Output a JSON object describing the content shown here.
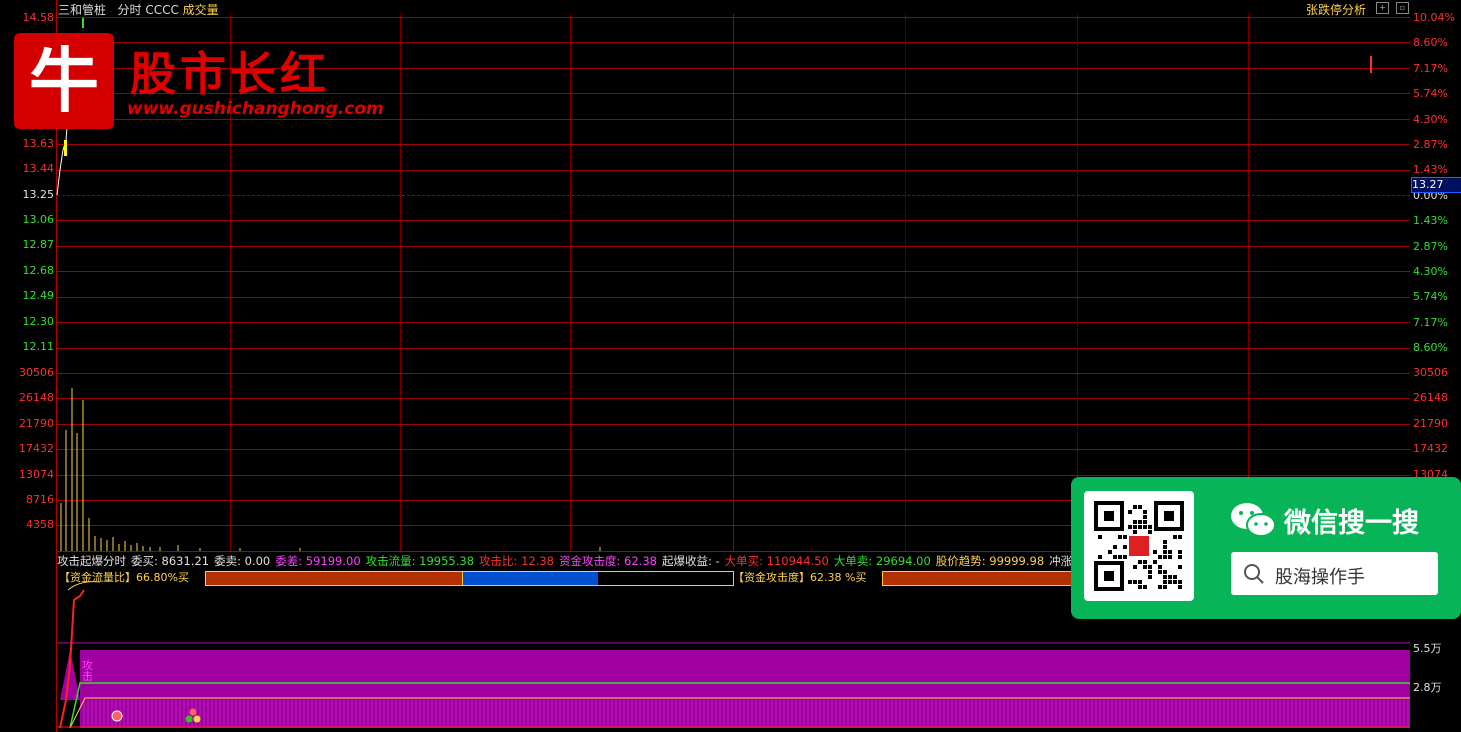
{
  "header": {
    "stock_name": "三和管桩",
    "mode": "分时",
    "code": "CCCC",
    "indicator": "成交量",
    "analysis_link": "张跌停分析"
  },
  "price_axis": {
    "left_labels": [
      {
        "text": "14.58",
        "color": "red"
      },
      {
        "text": "13.63",
        "color": "red"
      },
      {
        "text": "13.44",
        "color": "red"
      },
      {
        "text": "13.25",
        "color": "white"
      },
      {
        "text": "13.06",
        "color": "green"
      },
      {
        "text": "12.87",
        "color": "green"
      },
      {
        "text": "12.68",
        "color": "green"
      },
      {
        "text": "12.49",
        "color": "green"
      },
      {
        "text": "12.30",
        "color": "green"
      },
      {
        "text": "12.11",
        "color": "green"
      }
    ],
    "right_labels": [
      {
        "text": "10.04%",
        "color": "red"
      },
      {
        "text": "8.60%",
        "color": "red"
      },
      {
        "text": "7.17%",
        "color": "red"
      },
      {
        "text": "5.74%",
        "color": "red"
      },
      {
        "text": "4.30%",
        "color": "red"
      },
      {
        "text": "2.87%",
        "color": "red"
      },
      {
        "text": "1.43%",
        "color": "red"
      },
      {
        "text": "0.00%",
        "color": "white"
      },
      {
        "text": "1.43%",
        "color": "green"
      },
      {
        "text": "2.87%",
        "color": "green"
      },
      {
        "text": "4.30%",
        "color": "green"
      },
      {
        "text": "5.74%",
        "color": "green"
      },
      {
        "text": "7.17%",
        "color": "green"
      },
      {
        "text": "8.60%",
        "color": "green"
      }
    ],
    "current_price": "13.27"
  },
  "volume_axis": {
    "labels": [
      "30506",
      "26148",
      "21790",
      "17432",
      "13074",
      "8716",
      "4358"
    ],
    "right_labels": [
      "30506",
      "26148",
      "21790",
      "17432",
      "13074"
    ]
  },
  "brand": {
    "logo_char": "牛",
    "name": "股市长红",
    "url": "www.gushichanghong.com"
  },
  "stats_bar": {
    "title": "攻击起爆分时",
    "items": [
      {
        "text": "委买: 8631.21",
        "color": "w"
      },
      {
        "text": "委卖: 0.00",
        "color": "w"
      },
      {
        "text": "委差: 59199.00",
        "color": "m"
      },
      {
        "text": "攻击流量: 19955.38",
        "color": "g"
      },
      {
        "text": "攻击比: 12.38",
        "color": "r"
      },
      {
        "text": "资金攻击度: 62.38",
        "color": "m"
      },
      {
        "text": "起爆收益: -",
        "color": "w"
      },
      {
        "text": "大单买: 110944.50",
        "color": "r"
      },
      {
        "text": "大单卖: 29694.00",
        "color": "g"
      },
      {
        "text": "股价趋势: 99999.98",
        "color": "y"
      },
      {
        "text": "冲涨停:",
        "color": "w"
      }
    ]
  },
  "indicator_bars": {
    "flow_ratio_label": "【资金流量比】66.80%买",
    "attack_label": "【资金攻击度】62.38 %买"
  },
  "lower_axis": {
    "labels": [
      "5.5万",
      "2.8万"
    ],
    "attack_text": "攻击"
  },
  "wechat_ad": {
    "title": "微信搜一搜",
    "search_text": "股海操作手"
  },
  "colors": {
    "grid": "#a00000",
    "up": "#ff3030",
    "down": "#30e030",
    "magenta_fill": "#a000a0",
    "wechat_green": "#07b558"
  }
}
